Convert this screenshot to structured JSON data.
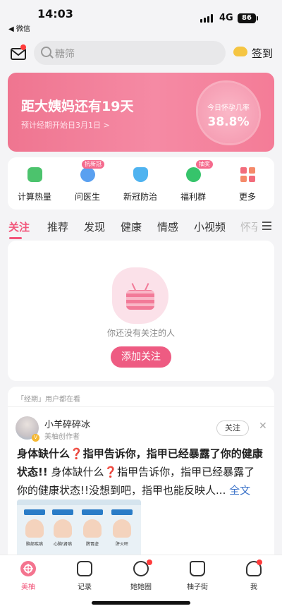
{
  "status_bar": {
    "time": "14:03",
    "back_app": "◀ 微信",
    "network": "4G",
    "battery": "86"
  },
  "header": {
    "search_placeholder": "糖筛",
    "signin_label": "签到"
  },
  "banner": {
    "title": "距大姨妈还有19天",
    "subtitle": "预计经期开始日3月1日 >",
    "rate_label": "今日怀孕几率",
    "rate_value": "38.8%"
  },
  "quick_menu": [
    {
      "label": "计算热量",
      "icon": "calculator-icon",
      "color": "#4cc36d",
      "badge": ""
    },
    {
      "label": "问医生",
      "icon": "doctor-icon",
      "color": "#5aa0f0",
      "badge": "抗新冠"
    },
    {
      "label": "新冠防治",
      "icon": "shield-icon",
      "color": "#4fb3f0",
      "badge": ""
    },
    {
      "label": "福利群",
      "icon": "chat-group-icon",
      "color": "#36c46b",
      "badge": "抽奖"
    },
    {
      "label": "更多",
      "icon": "grid-icon",
      "color": "#f26c7c",
      "badge": ""
    }
  ],
  "tabs": [
    "关注",
    "推荐",
    "发现",
    "健康",
    "情感",
    "小视频",
    "怀孕"
  ],
  "follow_empty": {
    "message": "你还没有关注的人",
    "button": "添加关注"
  },
  "feed": {
    "context": "「经期」用户都在看",
    "author": "小羊碎碎冰",
    "author_role": "美柚创作者",
    "follow": "关注",
    "close": "✕",
    "title_a": "身体缺什么",
    "q1": "❓",
    "title_b": "指甲告诉你，指甲已经暴露了你的健康状态!!",
    "body_a": " 身体缺什么",
    "q2": "❓",
    "body_b": "指甲告诉你，指甲已经暴露了你的健康状态!!没想到吧，指甲也能反映人...",
    "more": " 全文",
    "thumb_captions": [
      "脑部疾病",
      "心脑\\肾病",
      "脾胃虚",
      "肝火旺"
    ]
  },
  "bottom_nav": [
    {
      "label": "美柚",
      "icon": "meiyou-icon",
      "active": true
    },
    {
      "label": "记录",
      "icon": "calendar-icon",
      "active": false
    },
    {
      "label": "她她圈",
      "icon": "circle-icon",
      "active": false
    },
    {
      "label": "柚子街",
      "icon": "shop-bag-icon",
      "active": false
    },
    {
      "label": "我",
      "icon": "profile-icon",
      "active": false
    }
  ],
  "colors": {
    "accent": "#f2557a",
    "banner": "#ef7590",
    "link": "#3d74c9"
  }
}
